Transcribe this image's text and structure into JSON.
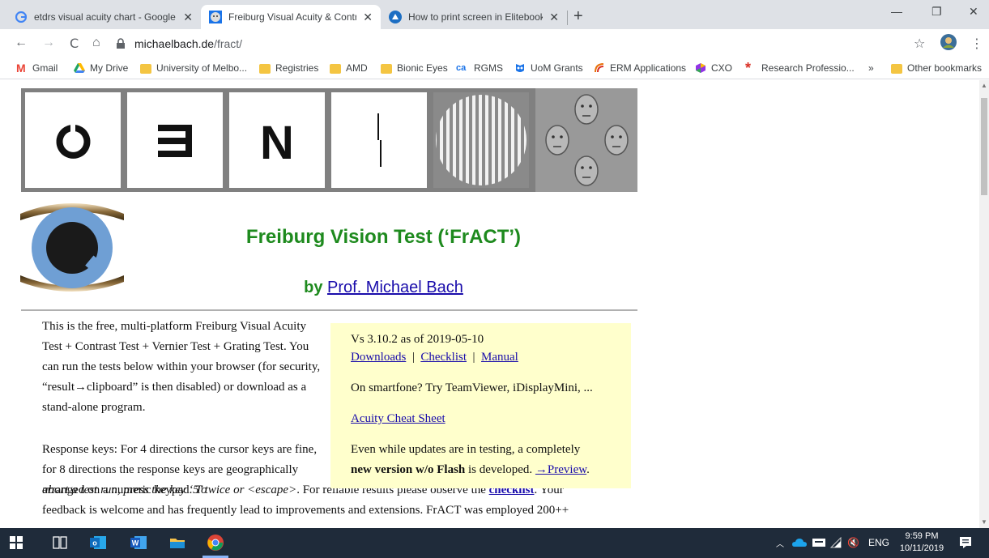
{
  "tabs": [
    {
      "title": "etdrs visual acuity chart - Google",
      "active": false
    },
    {
      "title": "Freiburg Visual Acuity & Contrast",
      "active": true
    },
    {
      "title": "How to print screen in Elitebook",
      "active": false
    }
  ],
  "window_controls": {
    "minimize": "—",
    "restore": "❐",
    "close": "✕"
  },
  "toolbar": {
    "back": "←",
    "forward": "→",
    "reload": "C",
    "home": "⌂",
    "url_host": "michaelbach.de",
    "url_path": "/fract/",
    "star": "☆",
    "menu": "⋮"
  },
  "bookmarks": [
    {
      "label": "Gmail",
      "icon": "gmail-icon",
      "color": "#ea4335"
    },
    {
      "label": "My Drive",
      "icon": "drive-icon",
      "color": "#1fa463"
    },
    {
      "label": "University of Melbo...",
      "icon": "folder-icon",
      "color": "#f4c542"
    },
    {
      "label": "Registries",
      "icon": "folder-icon",
      "color": "#f4c542"
    },
    {
      "label": "AMD",
      "icon": "folder-icon",
      "color": "#f4c542"
    },
    {
      "label": "Bionic Eyes",
      "icon": "folder-icon",
      "color": "#f4c542"
    },
    {
      "label": "RGMS",
      "icon": "rgms-icon",
      "color": "#1a73e8"
    },
    {
      "label": "UoM Grants",
      "icon": "owl-icon",
      "color": "#1a73e8"
    },
    {
      "label": "ERM Applications",
      "icon": "erm-icon",
      "color": "#e8710a"
    },
    {
      "label": "CXO",
      "icon": "cxo-icon",
      "color": "#9334e6"
    },
    {
      "label": "Research Professio...",
      "icon": "asterisk-icon",
      "color": "#d93025"
    },
    {
      "label": "»",
      "icon": "overflow-icon",
      "color": "#5f6368"
    },
    {
      "label": "Other bookmarks",
      "icon": "folder-icon",
      "color": "#f4c542"
    }
  ],
  "page": {
    "title": "Freiburg Vision Test (‘FrACT’)",
    "by": "by",
    "author": "Prof. Michael Bach",
    "para1": "This is the free, multi-platform Freiburg Visual Acuity Test + Contrast Test + Vernier Test + Grating Test. You can run the tests below within your browser (for security, “result→clipboard” is then disabled) or download as a stand-alone program.",
    "para2_a": "Response keys: For 4 directions the cursor keys are fine, for 8 directions the response keys are geographically arranged on a numeric keypad.",
    "para2_italic1": "To",
    "para2_italic2": "abort a test run, press the key ‘5’ twice or <escape>",
    "para2_b": ". For reliable results please observe the ",
    "para2_link": "checklist",
    "para2_c": ". Your",
    "para3": "feedback is welcome and has frequently lead to improvements and extensions. FrACT was employed 200++",
    "infobox": {
      "version": "Vs 3.10.2 as of 2019-05-10",
      "links": [
        "Downloads",
        "Checklist",
        "Manual"
      ],
      "sep": "|",
      "smartphone": "On smartfone? Try TeamViewer, iDisplayMini, ...",
      "cheatsheet": "Acuity Cheat Sheet",
      "update_a": "Even while updates are in testing, a completely",
      "update_bold": "new version w/o Flash",
      "update_b": " is developed. ",
      "preview": "→Preview",
      "update_end": "."
    },
    "optotypes": [
      "landolt-c",
      "tumbling-e",
      "letter-n",
      "vernier",
      "grating",
      "faces"
    ],
    "optotype_letters": {
      "e": "Ǝ",
      "n": "N"
    }
  },
  "taskbar": {
    "tray_text": "ENG",
    "time": "9:59 PM",
    "date": "10/11/2019"
  },
  "colors": {
    "accent_green": "#1e8a1e",
    "link": "#1a0dab",
    "infobox_bg": "#ffffcc"
  }
}
